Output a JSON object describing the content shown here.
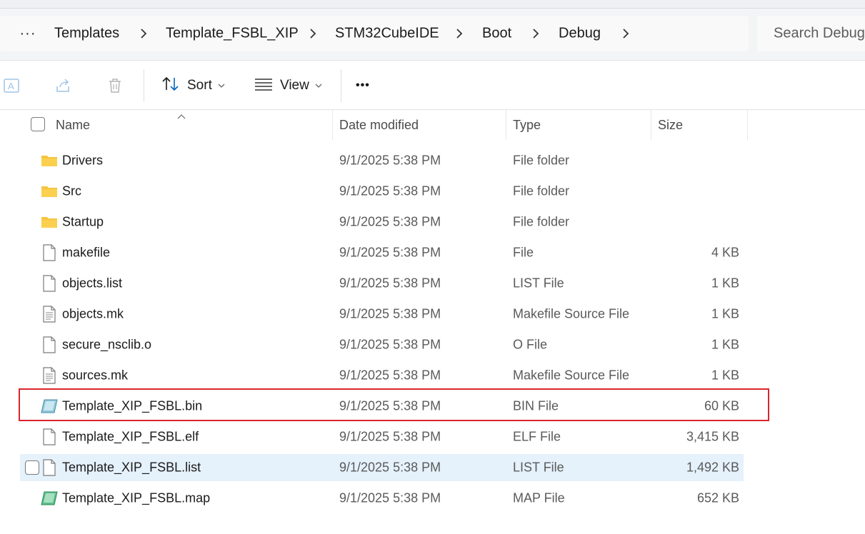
{
  "breadcrumb": {
    "more_label": "···",
    "items": [
      "Templates",
      "Template_FSBL_XIP",
      "STM32CubeIDE",
      "Boot",
      "Debug"
    ]
  },
  "search": {
    "placeholder": "Search Debug"
  },
  "commandbar": {
    "sort_label": "Sort",
    "view_label": "View",
    "more_label": "•••"
  },
  "columns": {
    "name": "Name",
    "date": "Date modified",
    "type": "Type",
    "size": "Size"
  },
  "files": [
    {
      "name": "Drivers",
      "date": "9/1/2025 5:38 PM",
      "type": "File folder",
      "size": "",
      "icon": "folder-icon"
    },
    {
      "name": "Src",
      "date": "9/1/2025 5:38 PM",
      "type": "File folder",
      "size": "",
      "icon": "folder-icon"
    },
    {
      "name": "Startup",
      "date": "9/1/2025 5:38 PM",
      "type": "File folder",
      "size": "",
      "icon": "folder-icon"
    },
    {
      "name": "makefile",
      "date": "9/1/2025 5:38 PM",
      "type": "File",
      "size": "4 KB",
      "icon": "file-icon"
    },
    {
      "name": "objects.list",
      "date": "9/1/2025 5:38 PM",
      "type": "LIST File",
      "size": "1 KB",
      "icon": "file-icon"
    },
    {
      "name": "objects.mk",
      "date": "9/1/2025 5:38 PM",
      "type": "Makefile Source File",
      "size": "1 KB",
      "icon": "text-file-icon"
    },
    {
      "name": "secure_nsclib.o",
      "date": "9/1/2025 5:38 PM",
      "type": "O File",
      "size": "1 KB",
      "icon": "file-icon"
    },
    {
      "name": "sources.mk",
      "date": "9/1/2025 5:38 PM",
      "type": "Makefile Source File",
      "size": "1 KB",
      "icon": "text-file-icon"
    },
    {
      "name": "Template_XIP_FSBL.bin",
      "date": "9/1/2025 5:38 PM",
      "type": "BIN File",
      "size": "60 KB",
      "icon": "bin-file-icon"
    },
    {
      "name": "Template_XIP_FSBL.elf",
      "date": "9/1/2025 5:38 PM",
      "type": "ELF File",
      "size": "3,415 KB",
      "icon": "file-icon"
    },
    {
      "name": "Template_XIP_FSBL.list",
      "date": "9/1/2025 5:38 PM",
      "type": "LIST File",
      "size": "1,492 KB",
      "icon": "file-icon"
    },
    {
      "name": "Template_XIP_FSBL.map",
      "date": "9/1/2025 5:38 PM",
      "type": "MAP File",
      "size": "652 KB",
      "icon": "map-file-icon"
    }
  ],
  "colors": {
    "highlight": "#d9262c",
    "hover_row": "#e5f1fb",
    "folder": "#f5c542",
    "accent": "#0067c0"
  }
}
